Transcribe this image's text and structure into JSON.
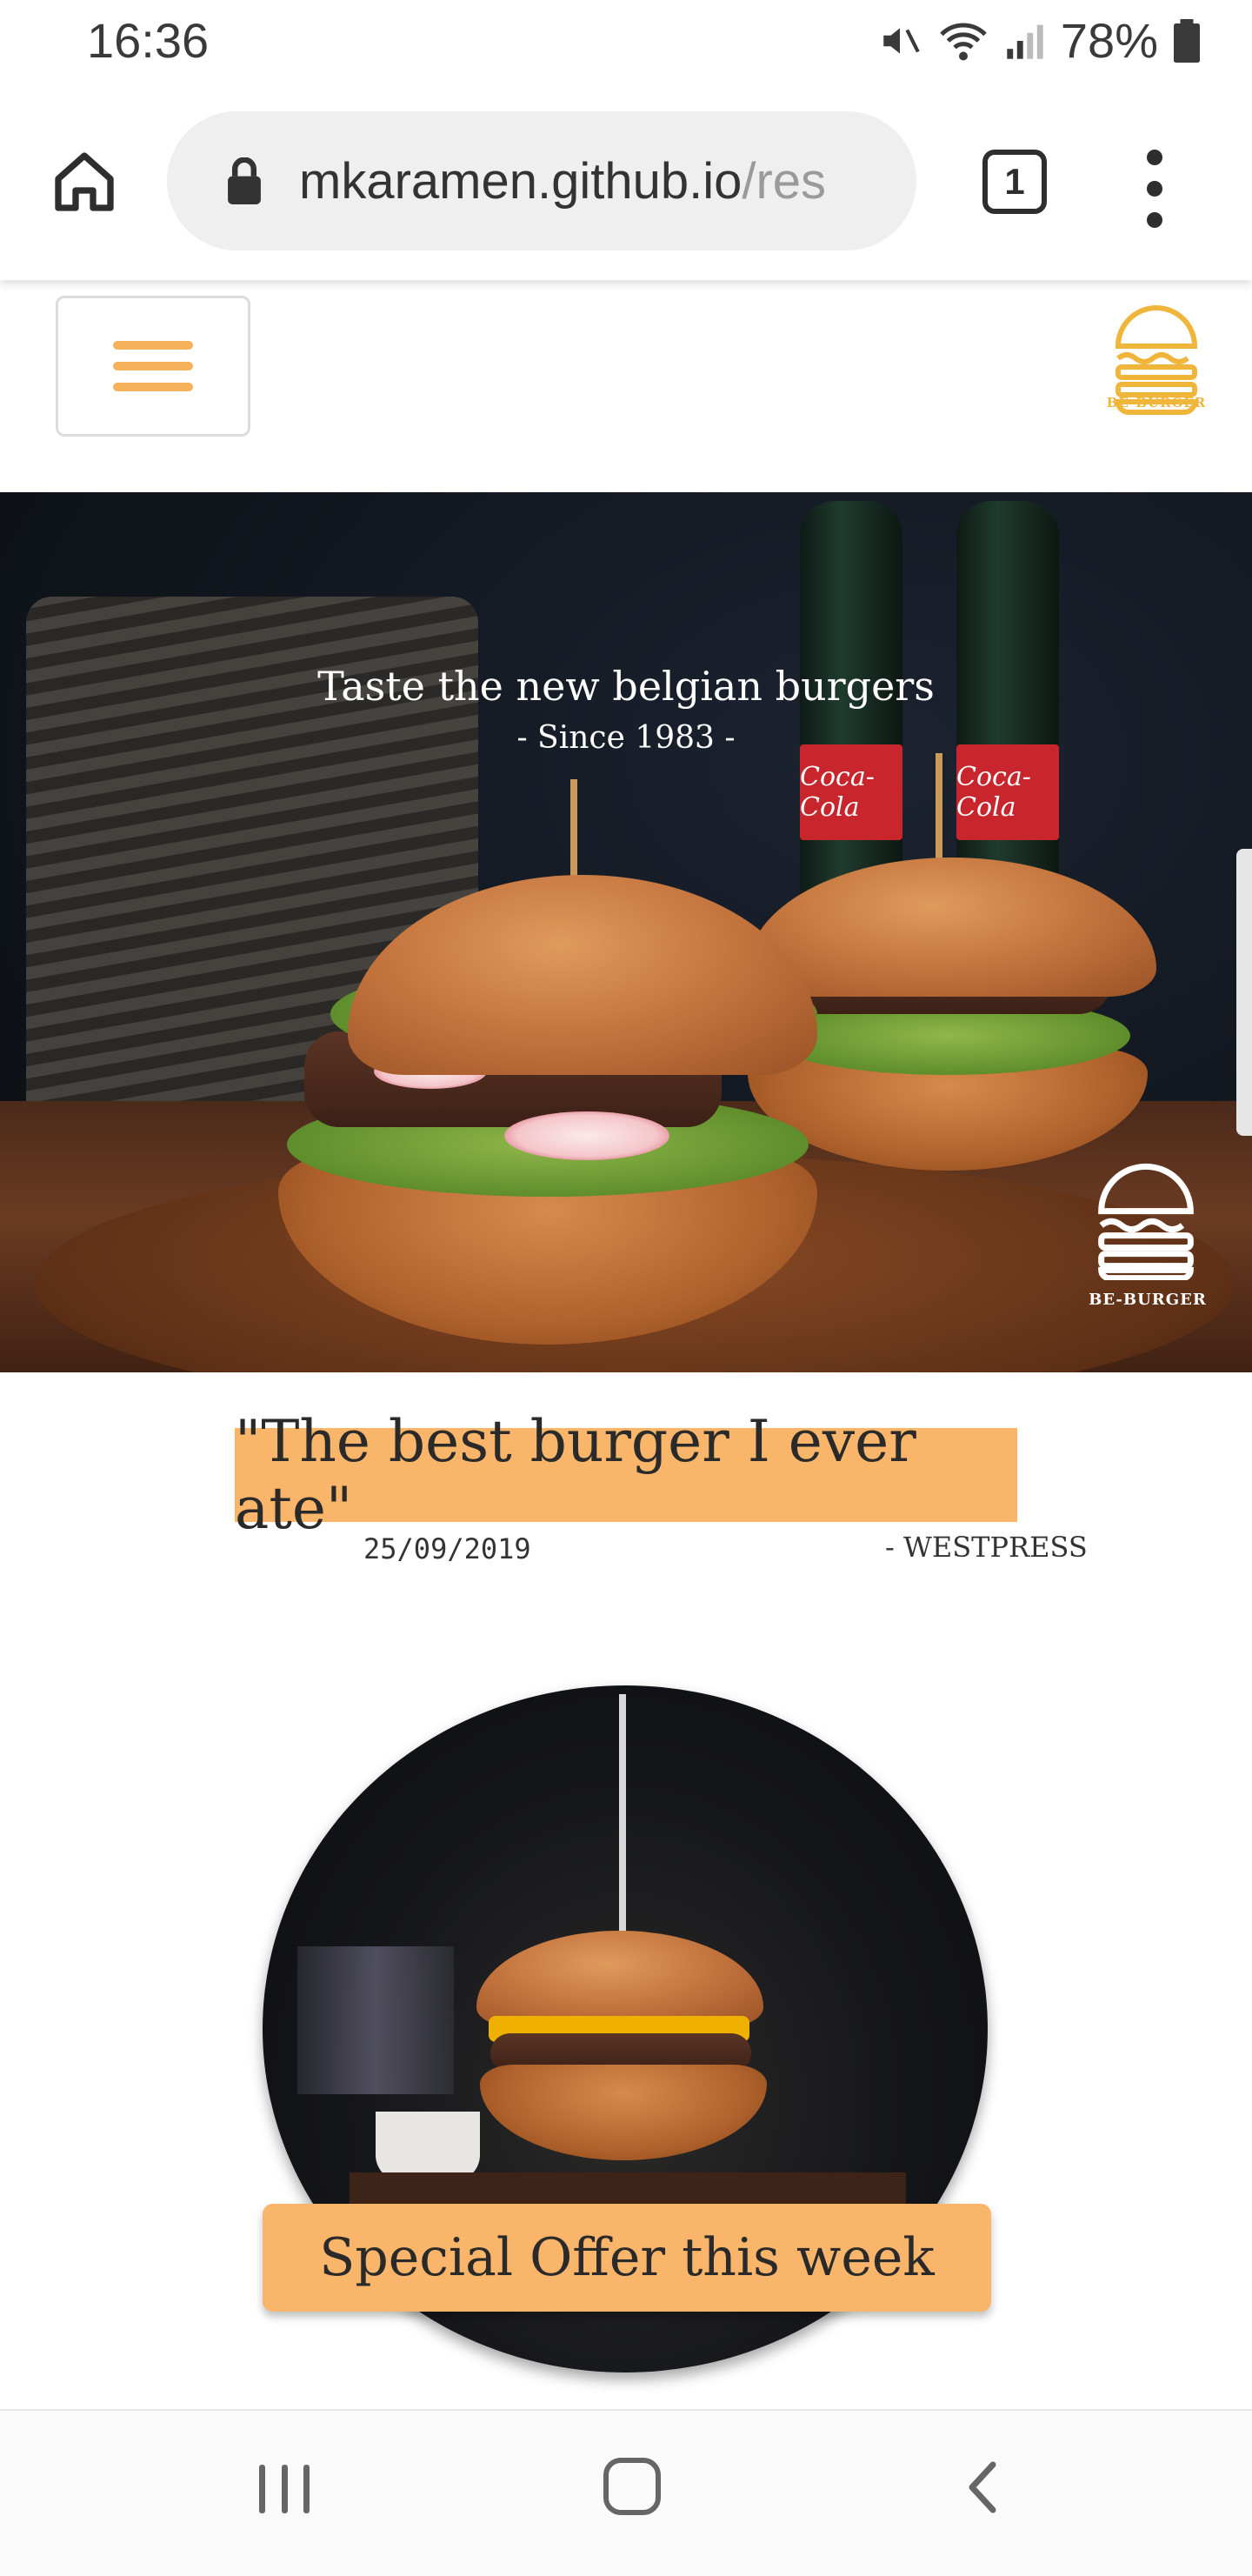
{
  "status_bar": {
    "time": "16:36",
    "battery": "78%"
  },
  "browser": {
    "url_visible": "mkaramen.github.io",
    "url_muted": "/res",
    "tab_count": "1"
  },
  "header": {
    "logo_text": "BE-BURGER"
  },
  "hero": {
    "title": "Taste the new belgian burgers",
    "subtitle": "- Since 1983 -",
    "bottle_brand": "Coca-Cola",
    "logo_text": "BE-BURGER"
  },
  "quote": {
    "text": "\"The best burger I ever ate\"",
    "date": "25/09/2019",
    "source": "- WESTPRESS"
  },
  "offer": {
    "button_label": "Special Offer this week"
  },
  "colors": {
    "accent": "#f9b56a",
    "logo_yellow": "#f0b63b",
    "hamburger": "#f6b25a"
  }
}
